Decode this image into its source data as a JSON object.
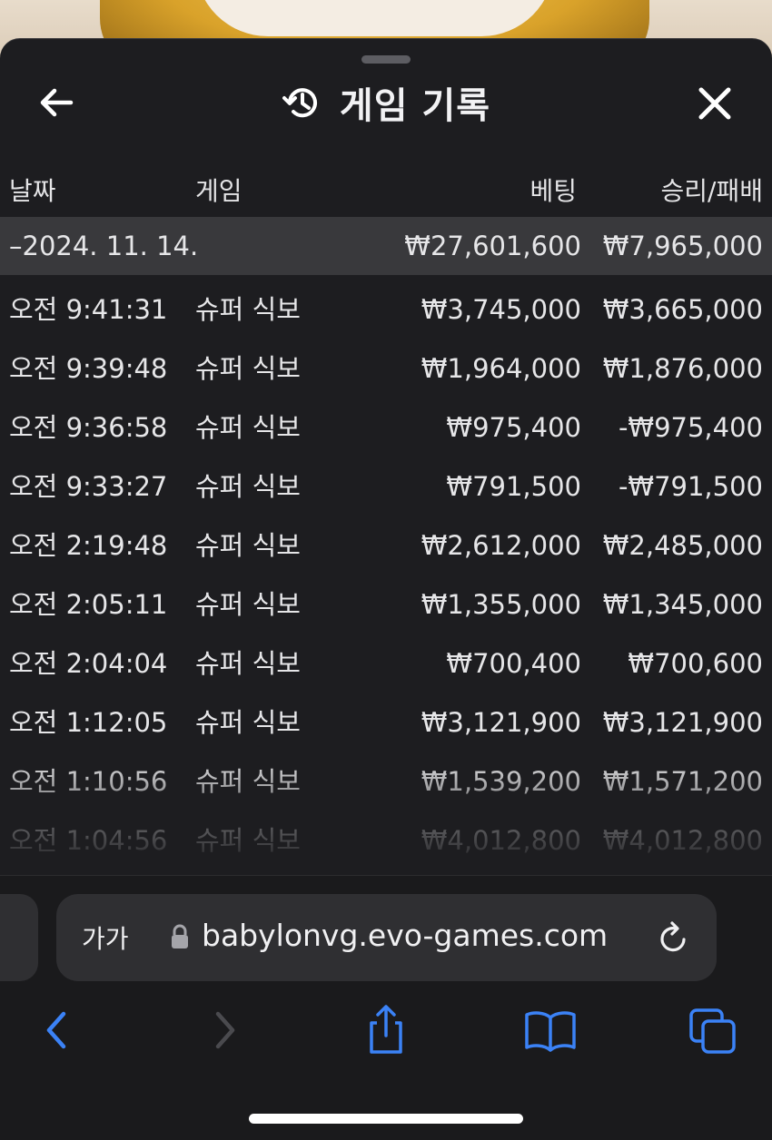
{
  "header": {
    "title": "게임 기록",
    "icons": {
      "back": "arrow-left-icon",
      "history": "history-icon",
      "close": "close-icon"
    }
  },
  "columns": {
    "date": "날짜",
    "game": "게임",
    "bet": "베팅",
    "result": "승리/패배"
  },
  "date_group": {
    "date": "–2024. 11. 14.",
    "bet_total": "₩27,601,600",
    "result_total": "₩7,965,000"
  },
  "rows": [
    {
      "time": "오전 9:41:31",
      "game": "슈퍼 식보",
      "bet": "₩3,745,000",
      "result": "₩3,665,000"
    },
    {
      "time": "오전 9:39:48",
      "game": "슈퍼 식보",
      "bet": "₩1,964,000",
      "result": "₩1,876,000"
    },
    {
      "time": "오전 9:36:58",
      "game": "슈퍼 식보",
      "bet": "₩975,400",
      "result": "-₩975,400"
    },
    {
      "time": "오전 9:33:27",
      "game": "슈퍼 식보",
      "bet": "₩791,500",
      "result": "-₩791,500"
    },
    {
      "time": "오전 2:19:48",
      "game": "슈퍼 식보",
      "bet": "₩2,612,000",
      "result": "₩2,485,000"
    },
    {
      "time": "오전 2:05:11",
      "game": "슈퍼 식보",
      "bet": "₩1,355,000",
      "result": "₩1,345,000"
    },
    {
      "time": "오전 2:04:04",
      "game": "슈퍼 식보",
      "bet": "₩700,400",
      "result": "₩700,600"
    },
    {
      "time": "오전 1:12:05",
      "game": "슈퍼 식보",
      "bet": "₩3,121,900",
      "result": "₩3,121,900"
    },
    {
      "time": "오전 1:10:56",
      "game": "슈퍼 식보",
      "bet": "₩1,539,200",
      "result": "₩1,571,200"
    },
    {
      "time": "오전 1:04:56",
      "game": "슈퍼 식보",
      "bet": "₩4,012,800",
      "result": "₩4,012,800"
    }
  ],
  "browser": {
    "aa_label": "가가",
    "url": "babylonvg.evo-games.com",
    "icons": {
      "lock": "lock-icon",
      "reload": "reload-icon",
      "back": "chevron-left-icon",
      "forward": "chevron-right-icon",
      "share": "share-icon",
      "bookmarks": "book-icon",
      "tabs": "tabs-icon"
    },
    "accent": "#3b82f6"
  }
}
